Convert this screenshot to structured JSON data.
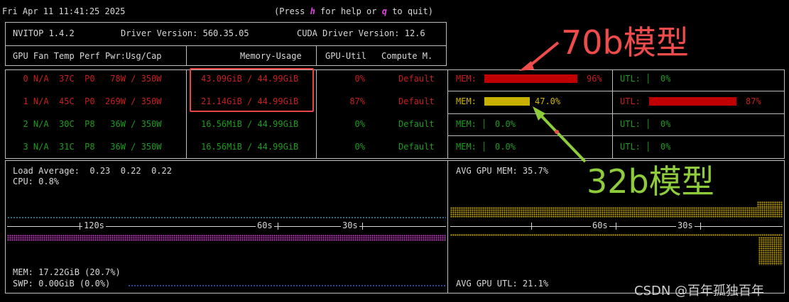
{
  "status_bar": {
    "datetime": "Fri Apr 11 11:41:25 2025",
    "help_prefix": "(Press ",
    "help_key": "h",
    "help_mid": " for help or ",
    "quit_key": "q",
    "help_suffix": " to quit)"
  },
  "header": {
    "nvitop": "NVITOP 1.4.2",
    "driver": "Driver Version: 560.35.05",
    "cuda": "CUDA Driver Version: 12.6",
    "col_left": "GPU Fan Temp Perf Pwr:Usg/Cap",
    "col_mem": "Memory-Usage",
    "col_util": "GPU-Util",
    "col_compute": "Compute M."
  },
  "gpus": [
    {
      "left": "  0 N/A  37C  P0   78W / 350W",
      "mem": "43.09GiB / 44.99GiB",
      "util": "0%",
      "mode": "Default",
      "mem_label": "MEM: ",
      "mem_pct": 0.96,
      "mem_text": "96%",
      "util_label": "UTL: │",
      "util_pct": 0,
      "util_text": "0%",
      "color": "#c81e1e",
      "util_color": "#1f9b1f"
    },
    {
      "left": "  1 N/A  45C  P0  269W / 350W",
      "mem": "21.14GiB / 44.99GiB",
      "util": "87%",
      "mode": "Default",
      "mem_label": "MEM: ",
      "mem_pct": 0.47,
      "mem_text": "47.0%",
      "util_label": "UTL: ",
      "util_pct": 0.87,
      "util_text": "87%",
      "color": "#c81e1e",
      "util_color": "#c81e1e"
    },
    {
      "left": "  2 N/A  30C  P8   36W / 350W",
      "mem": "16.56MiB / 44.99GiB",
      "util": "0%",
      "mode": "Default",
      "mem_label": "MEM: │",
      "mem_pct": 0,
      "mem_text": "0.0%",
      "util_label": "UTL: │",
      "util_pct": 0,
      "util_text": "0%",
      "color": "#1f9b1f",
      "util_color": "#1f9b1f"
    },
    {
      "left": "  3 N/A  31C  P8   36W / 350W",
      "mem": "16.56MiB / 44.99GiB",
      "util": "0%",
      "mode": "Default",
      "mem_label": "MEM: │",
      "mem_pct": 0,
      "mem_text": "0.0%",
      "util_label": "UTL: │",
      "util_pct": 0,
      "util_text": "0%",
      "color": "#1f9b1f",
      "util_color": "#1f9b1f"
    }
  ],
  "host": {
    "load": "Load Average:  0.23  0.22  0.22",
    "cpu": "CPU: 0.8%",
    "mem": "MEM: 17.22GiB (20.7%)",
    "swp": "SWP: 0.00GiB (0.0%)",
    "t120": "120s",
    "t60": "60s",
    "t30": "30s",
    "avg_mem": "AVG GPU MEM: 35.7%",
    "avg_utl": "AVG GPU UTL: 21.1%"
  },
  "annotations": {
    "label_70b": "70b模型",
    "label_32b": "32b模型",
    "color_70b": "#ef4b4b",
    "color_32b": "#8fcc3c"
  },
  "watermark": "CSDN @百年孤独百年"
}
